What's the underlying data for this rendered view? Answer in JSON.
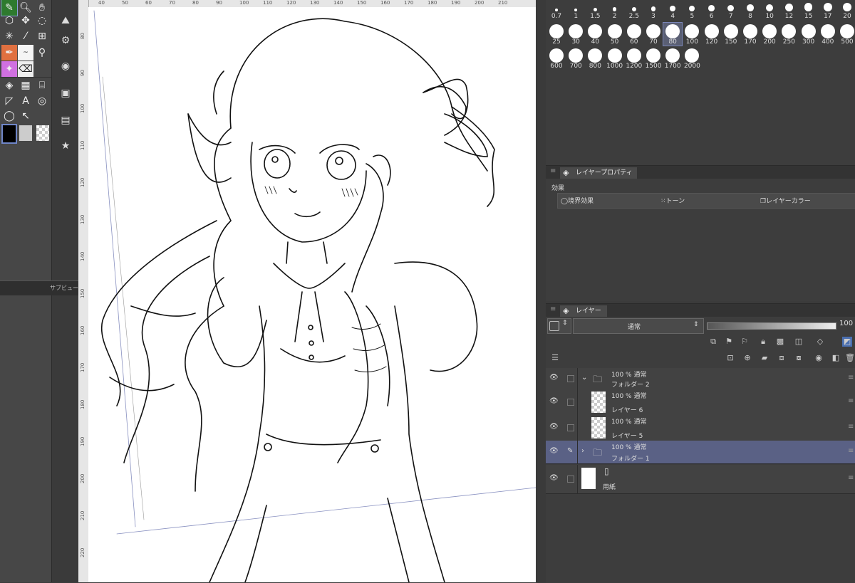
{
  "brush_sizes": {
    "row1": [
      "0.7",
      "1",
      "1.5",
      "2",
      "2.5",
      "3",
      "4",
      "5",
      "6",
      "7",
      "8",
      "10",
      "12",
      "15",
      "17",
      "20"
    ],
    "row2": [
      "25",
      "30",
      "40",
      "50",
      "60",
      "70",
      "80",
      "100",
      "120",
      "150",
      "170",
      "200",
      "250",
      "300",
      "400",
      "500"
    ],
    "row3": [
      "600",
      "700",
      "800",
      "1000",
      "1200",
      "1500",
      "1700",
      "2000"
    ],
    "selected": "80"
  },
  "subview": {
    "label": "サブビュー"
  },
  "ruler": {
    "h_ticks": [
      "40",
      "50",
      "60",
      "70",
      "80",
      "90",
      "100",
      "110",
      "120",
      "130",
      "140",
      "150",
      "160",
      "170",
      "180",
      "190",
      "200",
      "210"
    ],
    "v_ticks": [
      "80",
      "90",
      "100",
      "110",
      "120",
      "130",
      "140",
      "150",
      "160",
      "170",
      "180",
      "190",
      "200",
      "210",
      "220"
    ]
  },
  "layer_property": {
    "tab": "レイヤープロパティ",
    "section": "効果",
    "effects": [
      "境界効果",
      "トーン",
      "レイヤーカラー"
    ]
  },
  "layer_panel": {
    "tab": "レイヤー",
    "blend_mode": "通常",
    "opacity": "100",
    "layers": [
      {
        "line1": "100 % 通常",
        "line2": "フォルダー 2",
        "type": "folder",
        "expanded": true
      },
      {
        "line1": "100 % 通常",
        "line2": "レイヤー 6",
        "type": "raster"
      },
      {
        "line1": "100 % 通常",
        "line2": "レイヤー 5",
        "type": "raster"
      },
      {
        "line1": "100 % 通常",
        "line2": "フォルダー 1",
        "type": "folder",
        "expanded": false,
        "selected": true
      },
      {
        "line1": "",
        "line2": "用紙",
        "type": "paper"
      }
    ]
  },
  "colors": {
    "accent": "#5a6185",
    "main_color": "#000000",
    "sub_color": "#cccccc"
  }
}
